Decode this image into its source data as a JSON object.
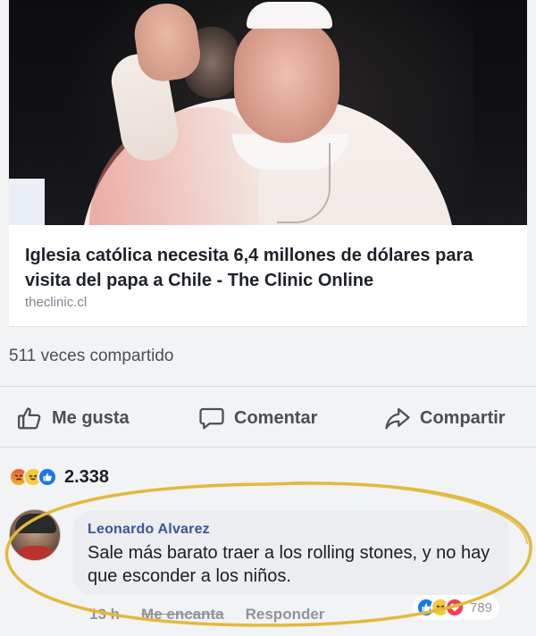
{
  "link_preview": {
    "title": "Iglesia católica necesita 6,4 millones de dólares para visita del papa a Chile - The Clinic Online",
    "domain": "theclinic.cl"
  },
  "shares_text": "511 veces compartido",
  "actions": {
    "like": "Me gusta",
    "comment": "Comentar",
    "share": "Compartir"
  },
  "reactions": {
    "icons": [
      "angry-icon",
      "haha-icon",
      "like-icon"
    ],
    "count": "2.338"
  },
  "comment": {
    "author": "Leonardo Alvarez",
    "text": "Sale más barato traer a los rolling stones, y no hay que esconder a los niños.",
    "time": "13 h",
    "like_label": "Me encanta",
    "reply_label": "Responder",
    "reaction_icons": [
      "like-icon",
      "haha-icon",
      "love-icon"
    ],
    "reaction_count": "789"
  },
  "colors": {
    "link_blue": "#385898",
    "like_blue": "#1877f2",
    "highlight_yellow": "#e2b93b",
    "love_red": "#f33e58"
  }
}
